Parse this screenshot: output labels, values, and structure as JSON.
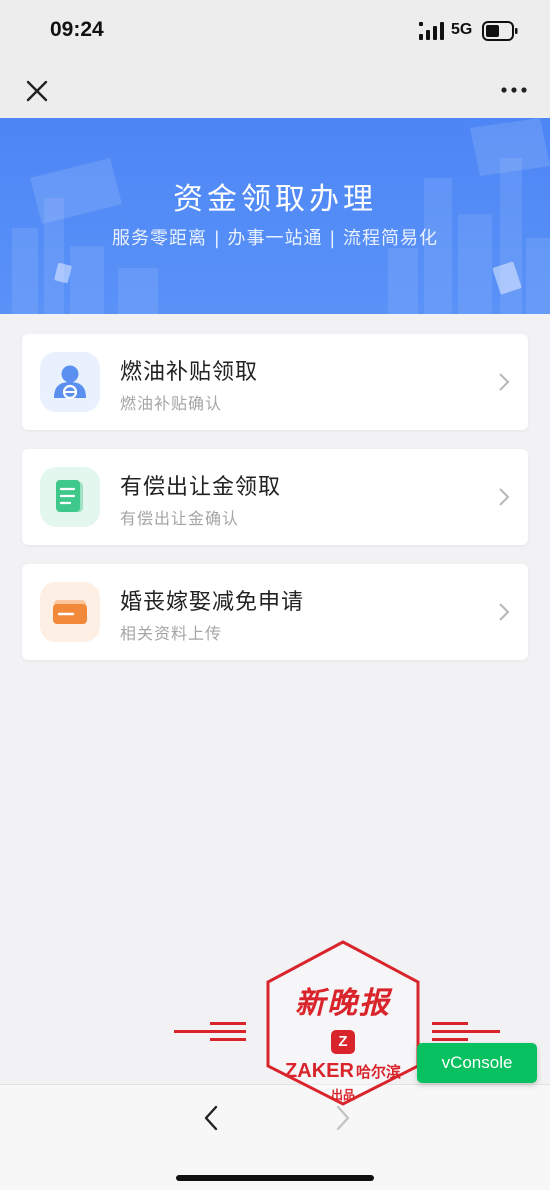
{
  "status_bar": {
    "time": "09:24",
    "network": "5G"
  },
  "nav": {
    "close_icon": "close-icon",
    "more_icon": "more-dots-icon"
  },
  "banner": {
    "title": "资金领取办理",
    "subtitle": "服务零距离 | 办事一站通 | 流程简易化",
    "color": "#4d86f5"
  },
  "services": [
    {
      "title": "燃油补贴领取",
      "subtitle": "燃油补贴确认",
      "icon": "driver-person-icon",
      "icon_bg": "#e8f1fd",
      "icon_color": "#5b8ff0"
    },
    {
      "title": "有偿出让金领取",
      "subtitle": "有偿出让金确认",
      "icon": "document-icon",
      "icon_bg": "#e4f7ee",
      "icon_color": "#3ec98a"
    },
    {
      "title": "婚丧嫁娶减免申请",
      "subtitle": "相关资料上传",
      "icon": "folder-icon",
      "icon_bg": "#fdefe4",
      "icon_color": "#f2893a"
    }
  ],
  "bottom_bar": {
    "back_icon": "chevron-left-icon",
    "forward_icon": "chevron-right-icon"
  },
  "vconsole": {
    "label": "vConsole",
    "color": "#07c160"
  },
  "watermark": {
    "name": "新晚报",
    "brand": "ZAKER",
    "city": "哈尔滨",
    "produced": "出品",
    "color": "#d9242b"
  }
}
